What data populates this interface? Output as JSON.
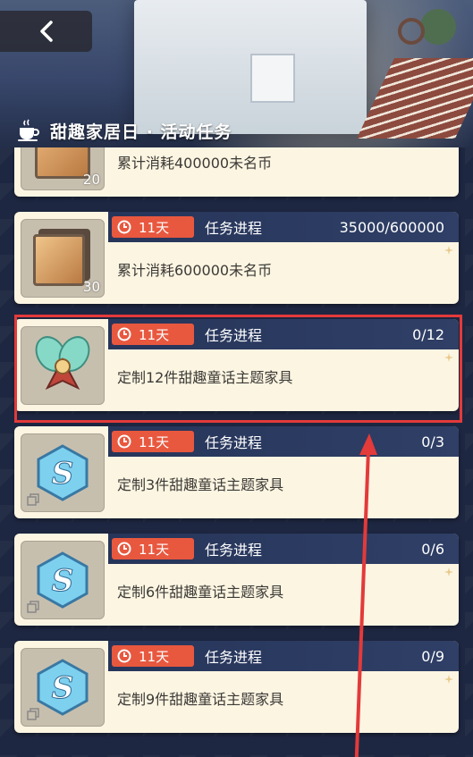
{
  "header": {
    "title": "甜趣家居日 · 活动任务",
    "back_icon": "chevron-left-icon",
    "title_icon": "coffee-cup-icon"
  },
  "colors": {
    "timer_badge": "#e8583f",
    "strip_bg": "#27355a",
    "card_bg": "#fbf5e2",
    "highlight": "#e33a3a"
  },
  "tasks": [
    {
      "thumb_icon": "wood-panel-icon",
      "count": "20",
      "timer": "",
      "progress_label": "",
      "progress_value": "",
      "description": "累计消耗400000未名币"
    },
    {
      "thumb_icon": "wood-panel-icon",
      "count": "30",
      "timer": "11天",
      "progress_label": "任务进程",
      "progress_value": "35000/600000",
      "description": "累计消耗600000未名币"
    },
    {
      "thumb_icon": "butterfly-emblem-icon",
      "count": "",
      "timer": "11天",
      "progress_label": "任务进程",
      "progress_value": "0/12",
      "description": "定制12件甜趣童话主题家具",
      "highlighted": true
    },
    {
      "thumb_icon": "s-hexagon-icon",
      "count": "",
      "timer": "11天",
      "progress_label": "任务进程",
      "progress_value": "0/3",
      "description": "定制3件甜趣童话主题家具"
    },
    {
      "thumb_icon": "s-hexagon-icon",
      "count": "",
      "timer": "11天",
      "progress_label": "任务进程",
      "progress_value": "0/6",
      "description": "定制6件甜趣童话主题家具"
    },
    {
      "thumb_icon": "s-hexagon-icon",
      "count": "",
      "timer": "11天",
      "progress_label": "任务进程",
      "progress_value": "0/9",
      "description": "定制9件甜趣童话主题家具"
    }
  ]
}
